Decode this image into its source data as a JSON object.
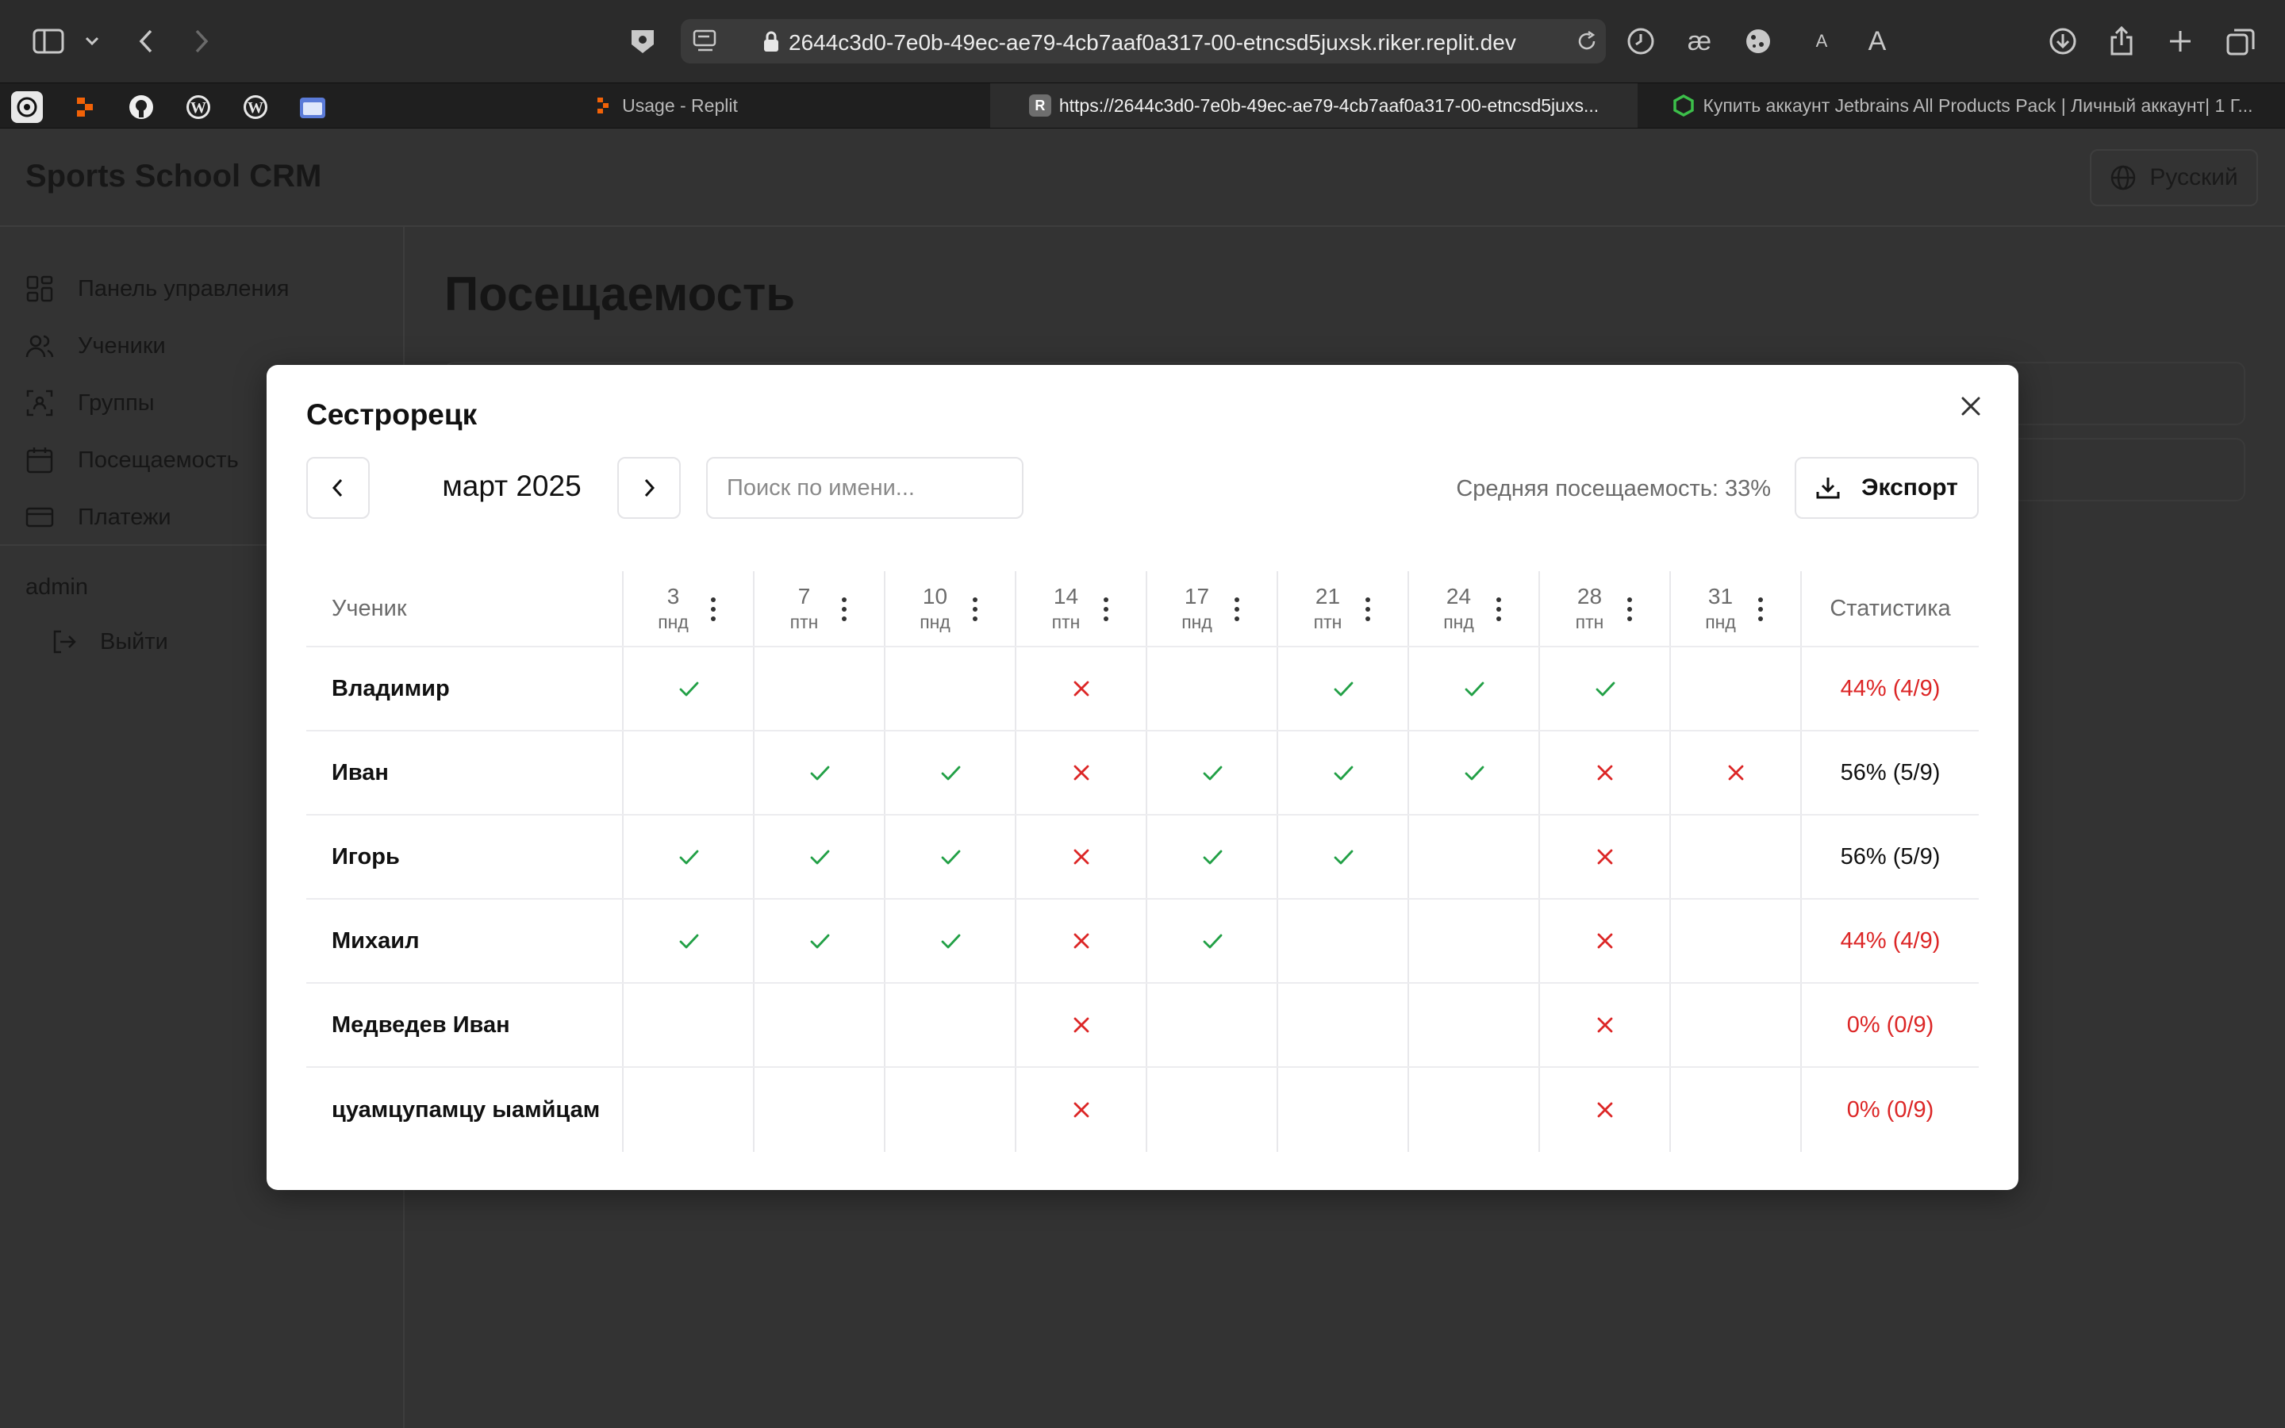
{
  "browser": {
    "url": "2644c3d0-7e0b-49ec-ae79-4cb7aaf0a317-00-etncsd5juxsk.riker.replit.dev",
    "tabs": [
      {
        "title": "Usage - Replit",
        "active": false
      },
      {
        "title": "https://2644c3d0-7e0b-49ec-ae79-4cb7aaf0a317-00-etncsd5juxs...",
        "active": true
      },
      {
        "title": "Купить аккаунт Jetbrains All Products Pack | Личный аккаунт| 1 Г...",
        "active": false
      }
    ],
    "bookmark_favicons": [
      "chatgpt-icon",
      "replit-icon",
      "github-icon",
      "wordpress-icon",
      "wordpress-icon",
      "folder-icon"
    ],
    "reader_font_small": "A",
    "reader_font_large": "A"
  },
  "app": {
    "title": "Sports School CRM",
    "language": "Русский",
    "nav": [
      {
        "label": "Панель управления",
        "icon": "dashboard-icon"
      },
      {
        "label": "Ученики",
        "icon": "users-icon"
      },
      {
        "label": "Группы",
        "icon": "groups-icon"
      },
      {
        "label": "Посещаемость",
        "icon": "calendar-icon"
      },
      {
        "label": "Платежи",
        "icon": "card-icon"
      }
    ],
    "user": "admin",
    "logout": "Выйти",
    "page_title": "Посещаемость"
  },
  "modal": {
    "title": "Сестрорецк",
    "month": "март 2025",
    "search_placeholder": "Поиск по имени...",
    "average": "Средняя посещаемость: 33%",
    "export_label": "Экспорт",
    "student_header": "Ученик",
    "stats_header": "Статистика",
    "days": [
      {
        "num": "3",
        "wd": "пнд"
      },
      {
        "num": "7",
        "wd": "птн"
      },
      {
        "num": "10",
        "wd": "пнд"
      },
      {
        "num": "14",
        "wd": "птн"
      },
      {
        "num": "17",
        "wd": "пнд"
      },
      {
        "num": "21",
        "wd": "птн"
      },
      {
        "num": "24",
        "wd": "пнд"
      },
      {
        "num": "28",
        "wd": "птн"
      },
      {
        "num": "31",
        "wd": "пнд"
      }
    ],
    "students": [
      {
        "name": "Владимир",
        "marks": [
          "y",
          "",
          "",
          "n",
          "",
          "y",
          "y",
          "y",
          ""
        ],
        "stat": "44% (4/9)",
        "low": true
      },
      {
        "name": "Иван",
        "marks": [
          "",
          "y",
          "y",
          "n",
          "y",
          "y",
          "y",
          "n",
          "n"
        ],
        "stat": "56% (5/9)",
        "low": false
      },
      {
        "name": "Игорь",
        "marks": [
          "y",
          "y",
          "y",
          "n",
          "y",
          "y",
          "",
          "n",
          ""
        ],
        "stat": "56% (5/9)",
        "low": false
      },
      {
        "name": "Михаил",
        "marks": [
          "y",
          "y",
          "y",
          "n",
          "y",
          "",
          "",
          "n",
          ""
        ],
        "stat": "44% (4/9)",
        "low": true
      },
      {
        "name": "Медведев Иван",
        "marks": [
          "",
          "",
          "",
          "n",
          "",
          "",
          "",
          "n",
          ""
        ],
        "stat": "0% (0/9)",
        "low": true
      },
      {
        "name": "цуамцупамцу ыамйцам",
        "marks": [
          "",
          "",
          "",
          "n",
          "",
          "",
          "",
          "n",
          ""
        ],
        "stat": "0% (0/9)",
        "low": true
      }
    ],
    "colors": {
      "present": "#22a046",
      "absent": "#dc2626",
      "low_stat": "#dc2626"
    }
  }
}
